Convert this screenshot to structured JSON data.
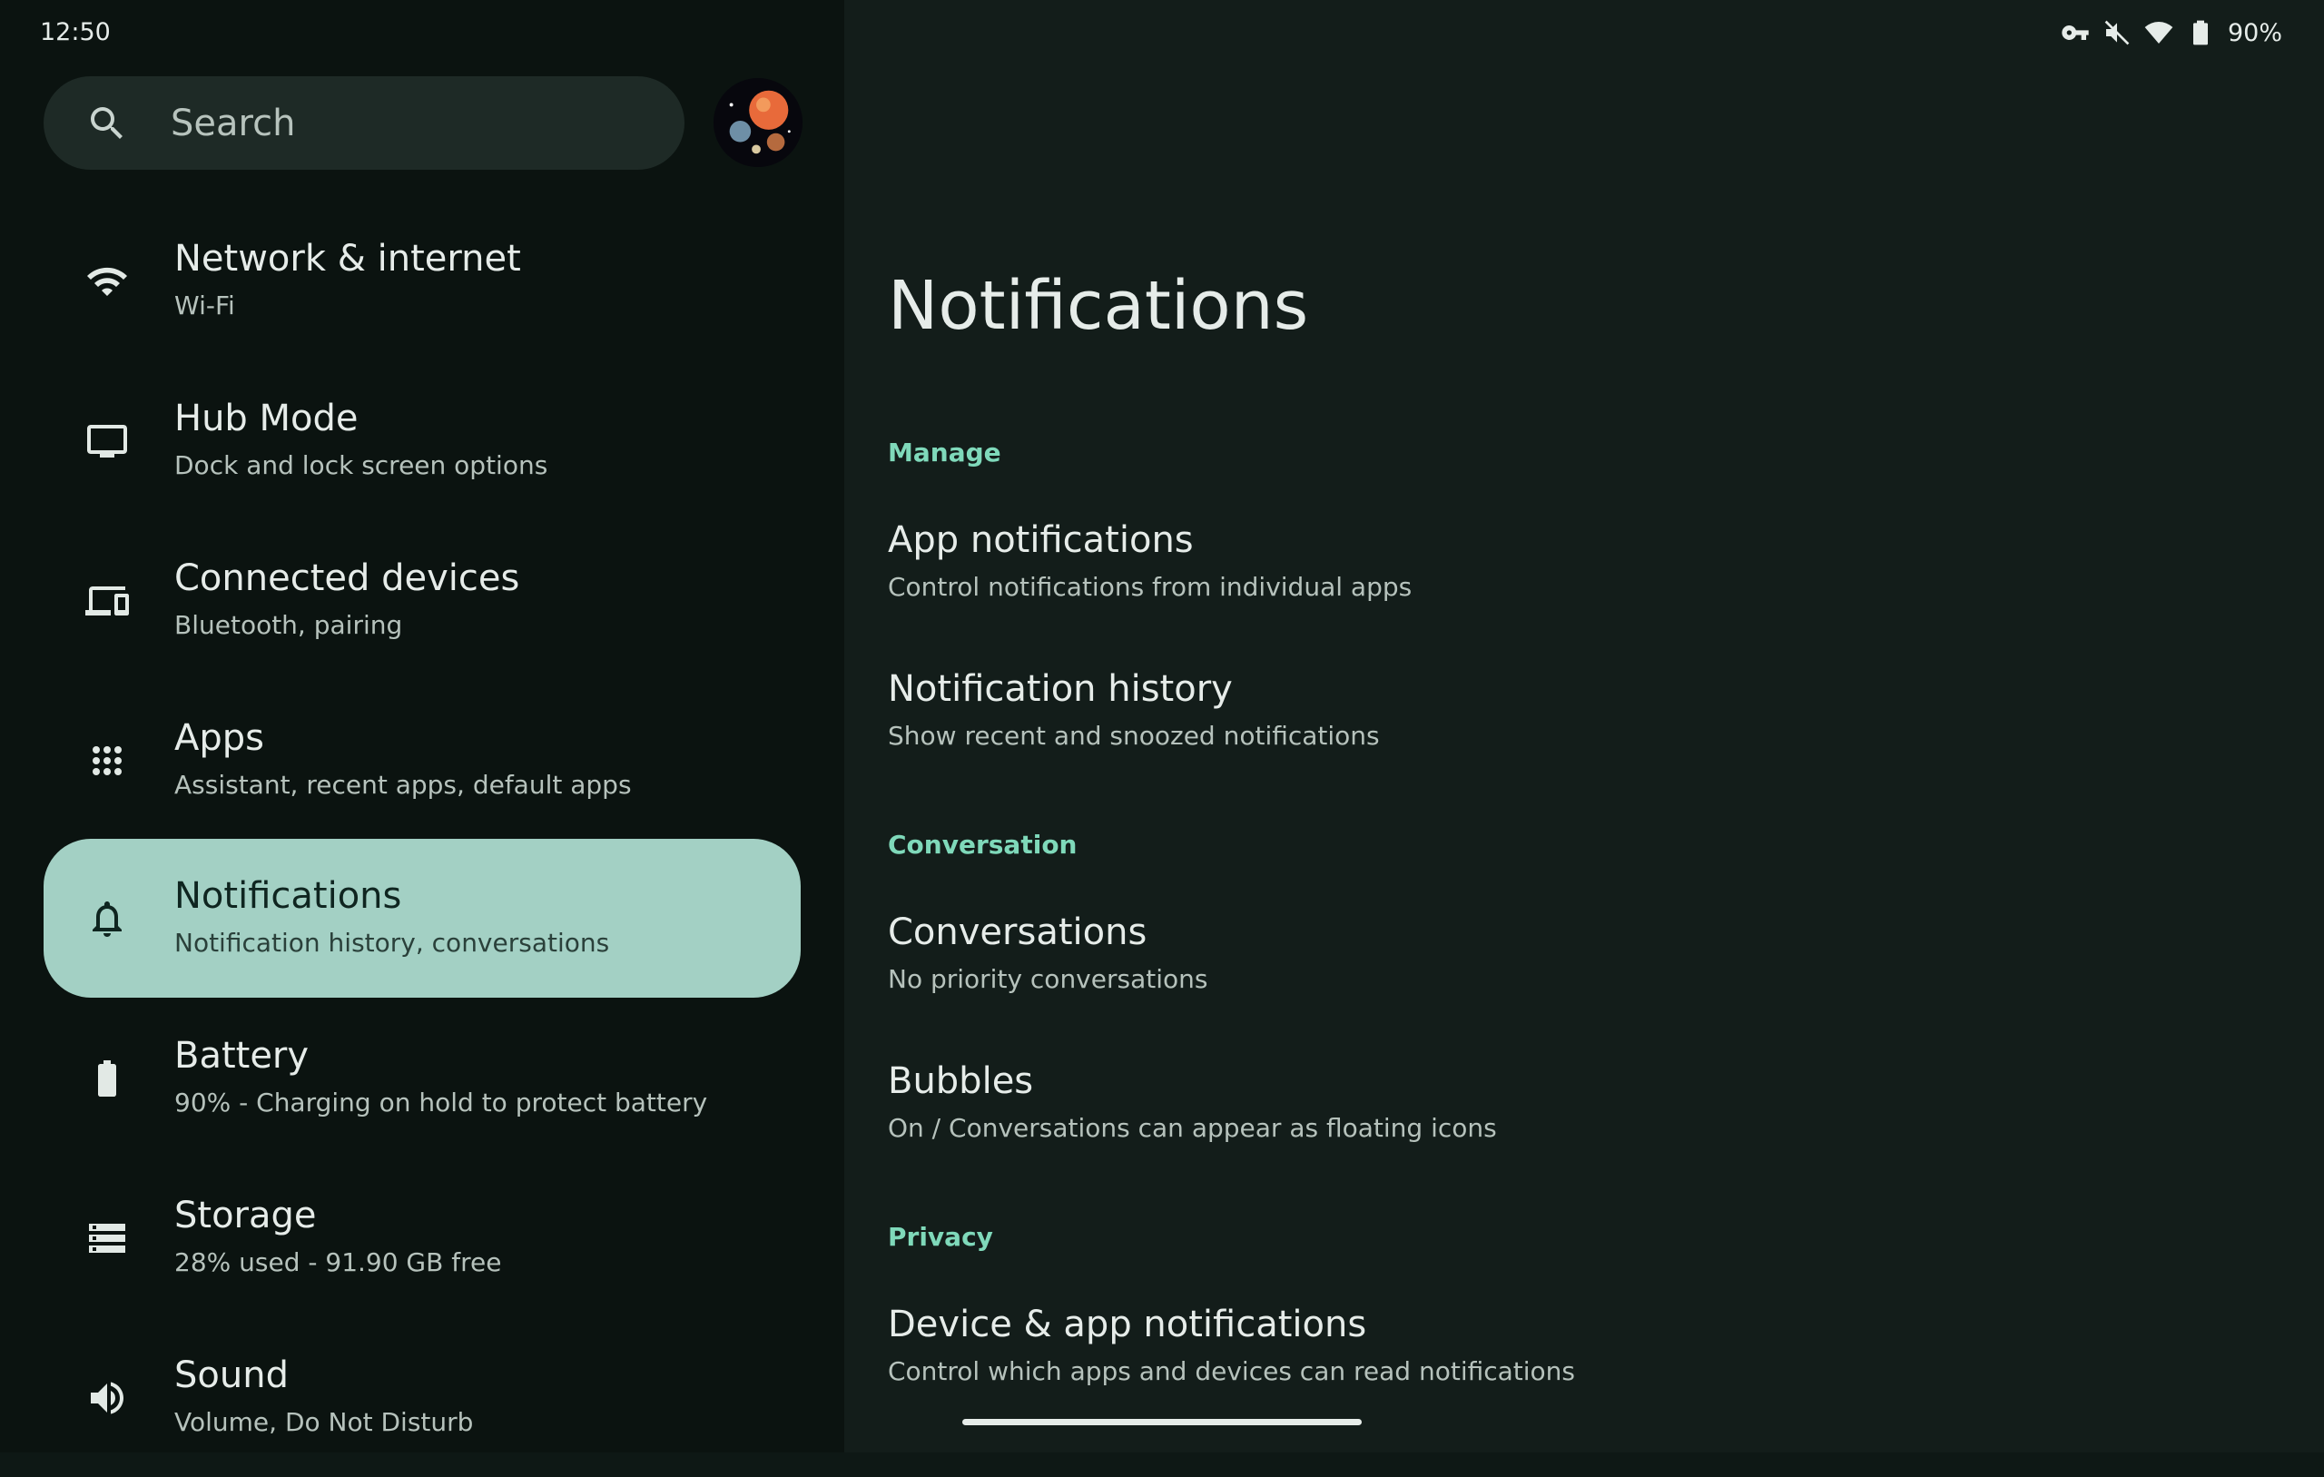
{
  "status_bar": {
    "time": "12:50",
    "battery_percent": "90%",
    "icons": [
      "vpn-key-icon",
      "vibrate-off-icon",
      "wifi-icon",
      "battery-charging-icon"
    ]
  },
  "sidebar": {
    "search_placeholder": "Search",
    "items": [
      {
        "icon": "wifi-icon",
        "title": "Network & internet",
        "subtitle": "Wi-Fi"
      },
      {
        "icon": "tv-icon",
        "title": "Hub Mode",
        "subtitle": "Dock and lock screen options"
      },
      {
        "icon": "devices-icon",
        "title": "Connected devices",
        "subtitle": "Bluetooth, pairing"
      },
      {
        "icon": "apps-grid-icon",
        "title": "Apps",
        "subtitle": "Assistant, recent apps, default apps"
      },
      {
        "icon": "bell-icon",
        "title": "Notifications",
        "subtitle": "Notification history, conversations",
        "selected": true
      },
      {
        "icon": "battery-icon",
        "title": "Battery",
        "subtitle": "90% - Charging on hold to protect battery"
      },
      {
        "icon": "storage-icon",
        "title": "Storage",
        "subtitle": "28% used - 91.90 GB free"
      },
      {
        "icon": "volume-icon",
        "title": "Sound",
        "subtitle": "Volume, Do Not Disturb"
      }
    ]
  },
  "main": {
    "title": "Notifications",
    "sections": [
      {
        "header": "Manage",
        "items": [
          {
            "title": "App notifications",
            "subtitle": "Control notifications from individual apps"
          },
          {
            "title": "Notification history",
            "subtitle": "Show recent and snoozed notifications"
          }
        ]
      },
      {
        "header": "Conversation",
        "items": [
          {
            "title": "Conversations",
            "subtitle": "No priority conversations"
          },
          {
            "title": "Bubbles",
            "subtitle": "On / Conversations can appear as floating icons"
          }
        ]
      },
      {
        "header": "Privacy",
        "items": [
          {
            "title": "Device & app notifications",
            "subtitle": "Control which apps and devices can read notifications"
          }
        ]
      }
    ]
  },
  "colors": {
    "accent": "#7fd9ba",
    "selected_bg": "#a3d0c4",
    "left_bg": "#0b1310",
    "right_bg": "#131d1a"
  }
}
